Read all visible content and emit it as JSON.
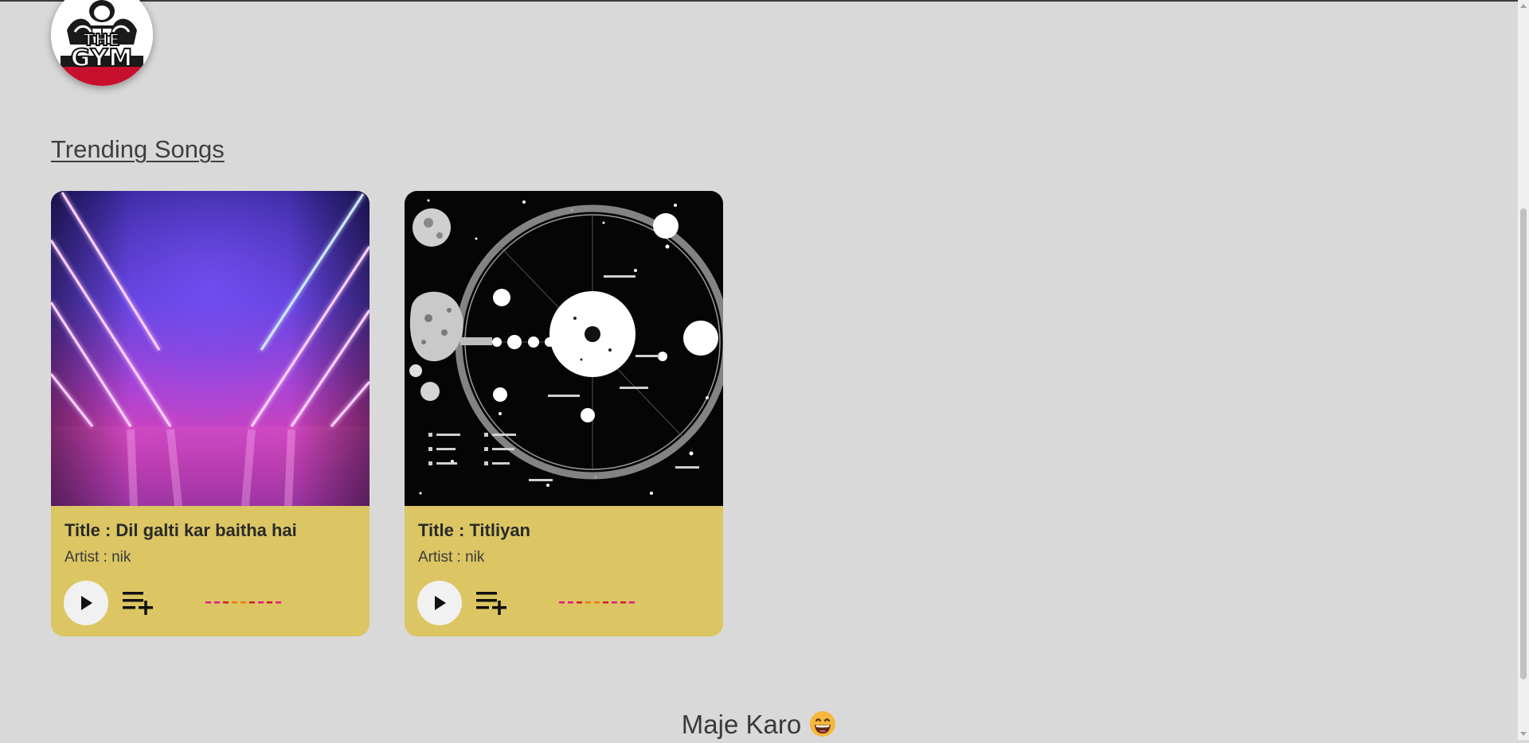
{
  "logo": {
    "line1": "THE",
    "line2": "GYM",
    "icon": "gym-logo-icon"
  },
  "section": {
    "title": "Trending Songs"
  },
  "songs": [
    {
      "title": "Title : Dil galti kar baitha hai",
      "artist": "Artist : nik",
      "cover_icon": "neon-lights-cover",
      "play_icon": "play-icon",
      "queue_icon": "add-to-queue-icon"
    },
    {
      "title": "Title : Titliyan",
      "artist": "Artist : nik",
      "cover_icon": "solar-system-cover",
      "play_icon": "play-icon",
      "queue_icon": "add-to-queue-icon"
    }
  ],
  "footer": {
    "text": "Maje Karo",
    "emoji_icon": "grinning-face-emoji"
  },
  "colors": {
    "background": "#d9d9d9",
    "card": "#dbc663",
    "wave_pink": "#e8148c",
    "wave_orange": "#f07a1a",
    "wave_red": "#d8142a"
  }
}
